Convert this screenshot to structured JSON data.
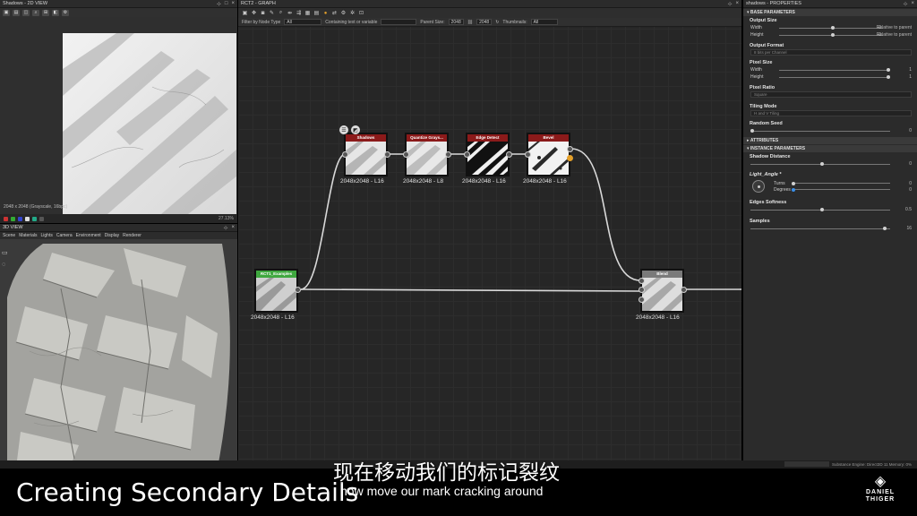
{
  "view2d": {
    "title": "Shadows - 2D VIEW",
    "info": "2048 x 2048 (Grayscale, 16bpc)",
    "zoom": "27.13%"
  },
  "view3d": {
    "title": "3D VIEW",
    "menu": [
      "Scene",
      "Materials",
      "Lights",
      "Camera",
      "Environment",
      "Display",
      "Renderer"
    ]
  },
  "graph": {
    "title": "RCT2 - GRAPH",
    "filters": {
      "filter_by_type_label": "Filter by Node Type",
      "filter_by_type_value": "All",
      "containing_label": "Containing text or variable",
      "parent_size_label": "Parent Size:",
      "parent_size_value": "2048",
      "size_value": "2048",
      "thumbnails_label": "Thumbnails:",
      "thumbnails_value": "All"
    },
    "nodes": [
      {
        "id": "shadows",
        "title": "Shadows",
        "label": "2048x2048 - L16"
      },
      {
        "id": "quantize",
        "title": "Quantize Grays...",
        "label": "2048x2048 - L8"
      },
      {
        "id": "edge",
        "title": "Edge Detect",
        "label": "2048x2048 - L16"
      },
      {
        "id": "bevel",
        "title": "Bevel",
        "label": "2048x2048 - L16"
      },
      {
        "id": "rct1",
        "title": "RCT1_Examples",
        "label": "2048x2048 - L16"
      },
      {
        "id": "blend",
        "title": "Blend",
        "label": "2048x2048 - L16"
      }
    ]
  },
  "props": {
    "title": "shadows - PROPERTIES",
    "base_section": "BASE PARAMETERS",
    "output_size": {
      "label": "Output Size",
      "width_label": "Width",
      "width_value": "0",
      "width_mode": "Relative to parent",
      "height_label": "Height",
      "height_value": "0",
      "height_mode": "Relative to parent"
    },
    "output_format": {
      "label": "Output Format",
      "value": "8 bits per Channel"
    },
    "pixel_size": {
      "label": "Pixel Size",
      "width_label": "Width",
      "width_value": "1",
      "height_label": "Height",
      "height_value": "1"
    },
    "pixel_ratio": {
      "label": "Pixel Ratio",
      "value": "Square"
    },
    "tiling_mode": {
      "label": "Tiling Mode",
      "value": "H and V Tiling"
    },
    "random_seed": {
      "label": "Random Seed",
      "value": "0"
    },
    "attributes_section": "ATTRIBUTES",
    "instance_section": "INSTANCE PARAMETERS",
    "shadow_distance": {
      "label": "Shadow Distance",
      "value": "0"
    },
    "light_angle": {
      "label": "Light_Angle *",
      "turns_label": "Turns",
      "turns_value": "0",
      "degrees_label": "Degrees",
      "degrees_value": "0"
    },
    "edges_softness": {
      "label": "Edges Softness",
      "value": "0.5"
    },
    "samples": {
      "label": "Samples",
      "value": "16"
    }
  },
  "status": {
    "engine": "Substance Engine: Direct3D 11  Memory: 0%"
  },
  "video": {
    "subtitle_zh": "现在移动我们的标记裂纹",
    "subtitle_en": "now move our mark cracking around",
    "lower_title": "Creating Secondary Details",
    "logo_line1": "DANIEL",
    "logo_line2": "THIGER"
  },
  "colors": {
    "node_header_red": "#8b1a1a",
    "node_header_green": "#3fa73f",
    "port_active": "#e4a02a"
  }
}
